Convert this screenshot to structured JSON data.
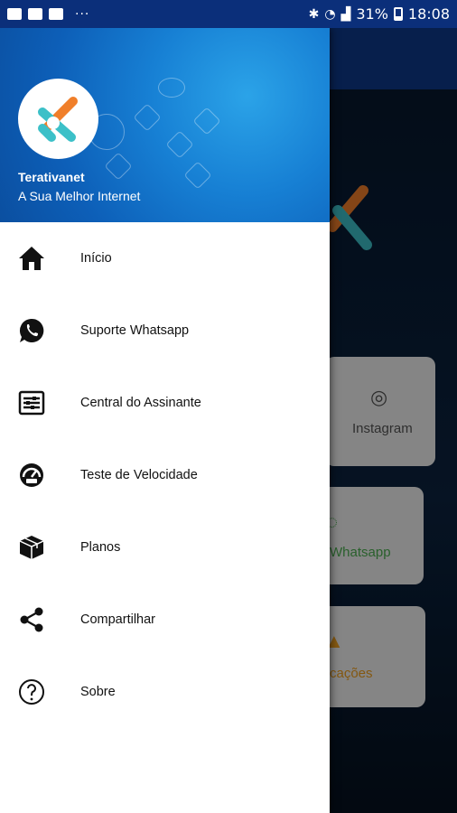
{
  "status_bar": {
    "notification_icons": [
      "gallery-icon",
      "youtube-icon",
      "youtube-icon"
    ],
    "more": "···",
    "battery": "31%",
    "time": "18:08"
  },
  "drawer": {
    "header": {
      "brand_name": "Terativanet",
      "tagline": "A Sua Melhor Internet",
      "logo_colors": [
        "#f07f2a",
        "#3cc0c8"
      ]
    },
    "items": [
      {
        "label": "Início",
        "icon": "home-icon"
      },
      {
        "label": "Suporte Whatsapp",
        "icon": "whatsapp-icon"
      },
      {
        "label": "Central do Assinante",
        "icon": "subscriber-center-icon"
      },
      {
        "label": "Teste de Velocidade",
        "icon": "speedometer-icon"
      },
      {
        "label": "Planos",
        "icon": "package-icon"
      },
      {
        "label": "Compartilhar",
        "icon": "share-icon"
      },
      {
        "label": "Sobre",
        "icon": "help-icon"
      }
    ]
  },
  "background": {
    "cards": [
      {
        "label": "Instagram",
        "icon": "instagram-icon"
      },
      {
        "label": "Whatsapp",
        "icon": "whatsapp-icon"
      },
      {
        "label": "cações",
        "icon": "bell-icon"
      }
    ]
  },
  "colors": {
    "status_bar": "#0b2f7a",
    "header_blue": "#1780d4",
    "accent_orange": "#f07f2a",
    "accent_teal": "#3cc0c8",
    "whatsapp_green": "#4caf50"
  }
}
